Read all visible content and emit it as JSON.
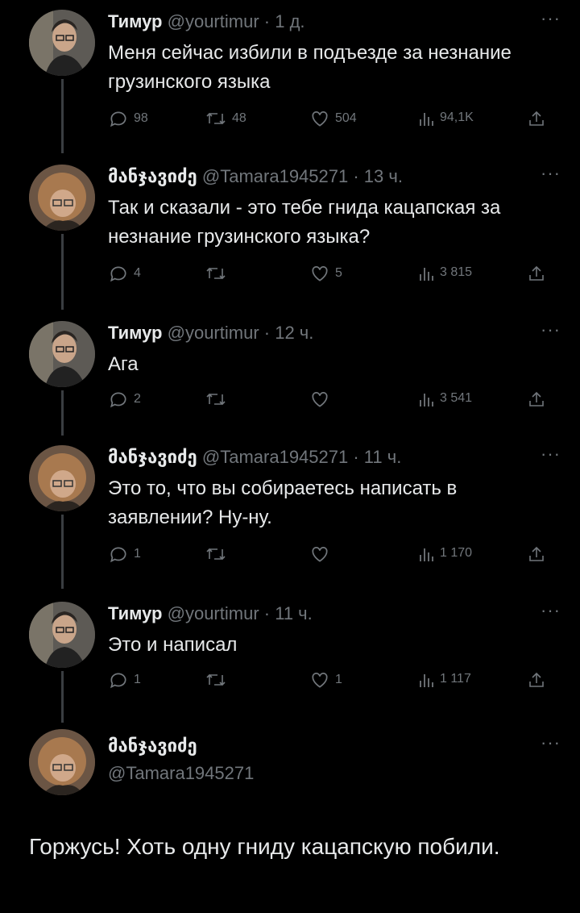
{
  "tweets": [
    {
      "name": "Тимур",
      "handle": "@yourtimur",
      "time": "· 1 д.",
      "text": "Меня сейчас избили в подъезде за незнание грузинского языка",
      "replies": "98",
      "retweets": "48",
      "likes": "504",
      "views": "94,1K",
      "avatar": "man"
    },
    {
      "name": "მანჯავიძე",
      "handle": "@Tamara1945271",
      "time": "· 13 ч.",
      "text": "Так и сказали - это тебе гнида кацапская за незнание грузинского языка?",
      "replies": "4",
      "retweets": "",
      "likes": "5",
      "views": "3 815",
      "avatar": "woman"
    },
    {
      "name": "Тимур",
      "handle": "@yourtimur",
      "time": "· 12 ч.",
      "text": "Ага",
      "replies": "2",
      "retweets": "",
      "likes": "",
      "views": "3 541",
      "avatar": "man"
    },
    {
      "name": "მანჯავიძე",
      "handle": "@Tamara1945271",
      "time": "· 11 ч.",
      "text": "Это то, что вы собираетесь написать в заявлении? Ну-ну.",
      "replies": "1",
      "retweets": "",
      "likes": "",
      "views": "1 170",
      "avatar": "woman"
    },
    {
      "name": "Тимур",
      "handle": "@yourtimur",
      "time": "· 11 ч.",
      "text": "Это и написал",
      "replies": "1",
      "retweets": "",
      "likes": "1",
      "views": "1 117",
      "avatar": "man"
    }
  ],
  "final": {
    "name": "მანჯავიძე",
    "handle": "@Tamara1945271",
    "text": "Горжусь! Хоть одну гниду кацапскую побили."
  },
  "more_label": "···",
  "colors": {
    "bg": "#000000",
    "text": "#e7e9ea",
    "muted": "#71767b",
    "thread_line": "#3a3d41"
  }
}
